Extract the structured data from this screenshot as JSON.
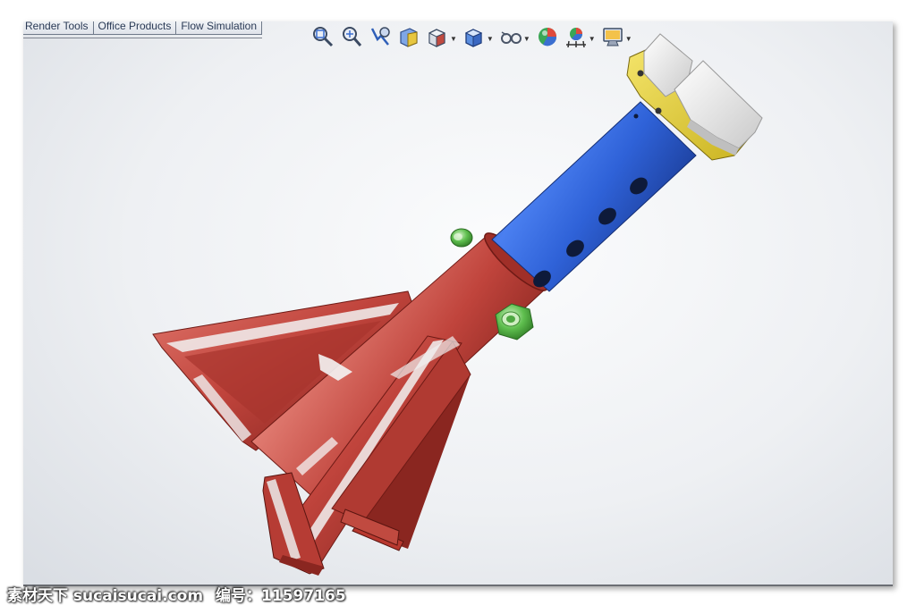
{
  "app": {
    "tabs": [
      {
        "label": "Render Tools"
      },
      {
        "label": "Office Products"
      },
      {
        "label": "Flow Simulation"
      }
    ]
  },
  "headsup_toolbar": {
    "buttons": [
      {
        "icon": "zoom-to-fit-icon",
        "dropdown": false
      },
      {
        "icon": "zoom-to-area-icon",
        "dropdown": false
      },
      {
        "icon": "previous-view-icon",
        "dropdown": false
      },
      {
        "icon": "section-view-icon",
        "dropdown": false
      },
      {
        "icon": "view-orientation-icon",
        "dropdown": true
      },
      {
        "icon": "display-style-icon",
        "dropdown": true
      },
      {
        "icon": "hide-show-items-icon",
        "dropdown": true
      },
      {
        "icon": "edit-appearance-icon",
        "dropdown": false
      },
      {
        "icon": "apply-scene-icon",
        "dropdown": true
      },
      {
        "icon": "view-settings-icon",
        "dropdown": true
      }
    ]
  },
  "model": {
    "colors": {
      "base": "#c0443c",
      "base_dark": "#8a2620",
      "tube": "#2f62d8",
      "tube_dark": "#1d3f9a",
      "saddle": "#e8e8e8",
      "clamp": "#e6d33a",
      "nut": "#5fbf4f"
    }
  },
  "watermark": {
    "site": "素材天下 sucaisucai.com",
    "id_text": "编号：11597165"
  }
}
